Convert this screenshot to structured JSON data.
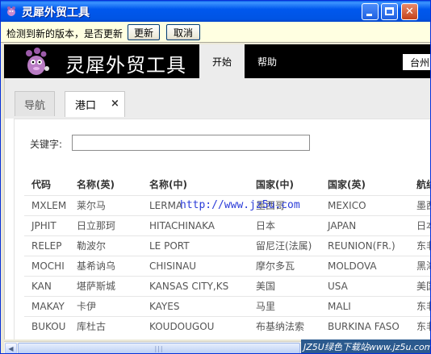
{
  "window": {
    "title": "灵犀外贸工具"
  },
  "updatebar": {
    "message": "检测到新的版本，是否更新",
    "update_label": "更新",
    "cancel_label": "取消"
  },
  "header": {
    "brand": "灵犀外贸工具",
    "nav": [
      {
        "label": "开始"
      },
      {
        "label": "帮助"
      }
    ],
    "city": "台州"
  },
  "tabs": [
    {
      "label": "导航"
    },
    {
      "label": "港口",
      "close": "×"
    }
  ],
  "search": {
    "label": "关键字:",
    "value": ""
  },
  "table": {
    "columns": [
      "代码",
      "名称(英)",
      "名称(中)",
      "国家(中)",
      "国家(英)",
      "航线"
    ],
    "rows": [
      [
        "MXLEM",
        "莱尔马",
        "LERMA",
        "墨西哥",
        "MEXICO",
        "墨西"
      ],
      [
        "JPHIT",
        "日立那珂",
        "HITACHINAKA",
        "日本",
        "JAPAN",
        "日本"
      ],
      [
        "RELEP",
        "勒波尔",
        "LE PORT",
        "留尼汪(法属)",
        "REUNION(FR.)",
        "东非"
      ],
      [
        "MOCHI",
        "基希讷乌",
        "CHISINAU",
        "摩尔多瓦",
        "MOLDOVA",
        "黑海"
      ],
      [
        "KAN",
        "堪萨斯城",
        "KANSAS CITY,KS",
        "美国",
        "USA",
        "美国"
      ],
      [
        "MAKAY",
        "卡伊",
        "KAYES",
        "马里",
        "MALI",
        "东非"
      ],
      [
        "BUKOU",
        "库杜古",
        "KOUDOUGOU",
        "布基纳法索",
        "BURKINA FASO",
        "东非"
      ]
    ]
  },
  "watermark": "http://www.jz5u.com",
  "footer": {
    "text": "JZ5U绿色下载站www.jz5u.com"
  },
  "colors": {
    "header_bg": "#000000",
    "titlebar": "#0054e3",
    "update_bg": "#ffffe1"
  },
  "icons": [
    "app-icon",
    "minimize-icon",
    "maximize-icon",
    "close-icon",
    "logo-icon",
    "tab-close-icon"
  ]
}
